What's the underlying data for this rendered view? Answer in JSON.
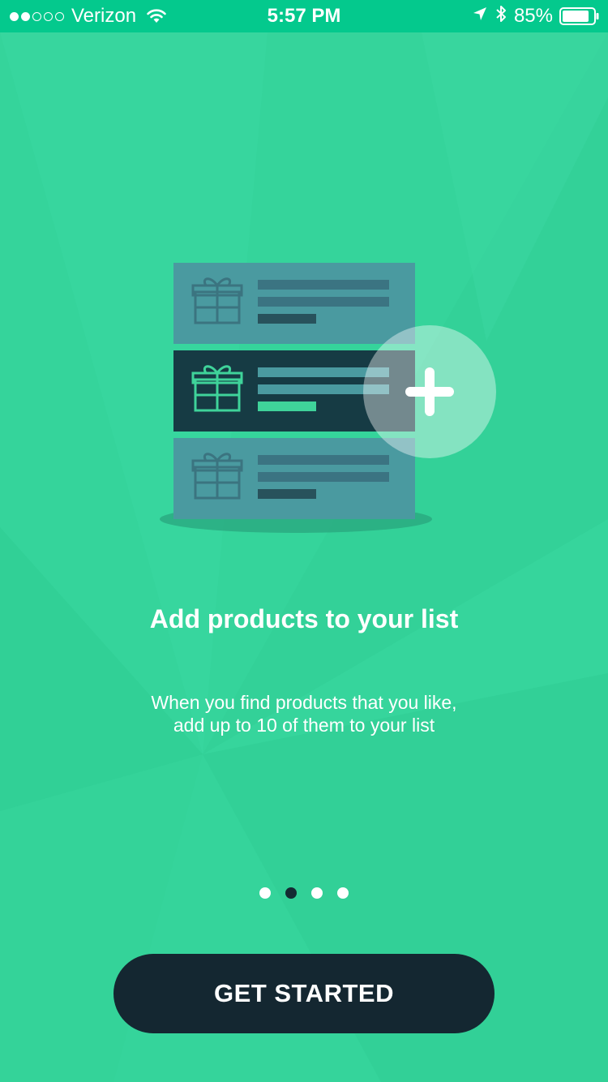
{
  "status_bar": {
    "carrier": "Verizon",
    "signal_bars_filled": 2,
    "signal_bars_total": 5,
    "time": "5:57 PM",
    "battery_percent": "85%",
    "icons": [
      "wifi-icon",
      "location-arrow-icon",
      "bluetooth-icon",
      "battery-icon"
    ]
  },
  "onboarding": {
    "title": "Add products to your list",
    "subtitle_line1": "When you find products that you like,",
    "subtitle_line2": "add up to 10 of them to your list",
    "pages_total": 4,
    "active_page": 2
  },
  "cta": {
    "label": "GET STARTED"
  },
  "colors": {
    "background": "#35d49b",
    "status_bar": "#04c98d",
    "card": "#4a9aa0",
    "card_selected": "#163b44",
    "button": "#142731",
    "accent": "#3fd39a"
  }
}
